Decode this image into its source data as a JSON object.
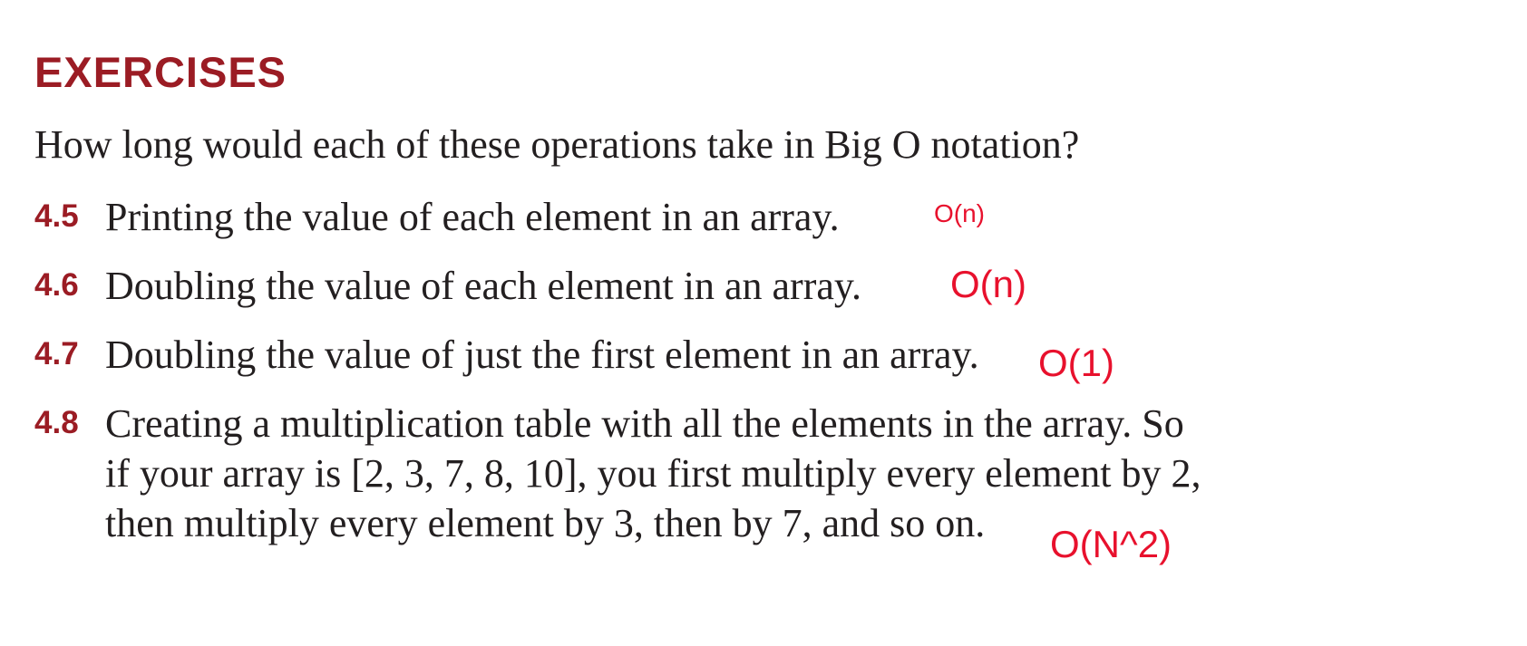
{
  "heading": "EXERCISES",
  "intro": "How long would each of these operations take in Big O notation?",
  "exercises": [
    {
      "number": "4.5",
      "lines": [
        "Printing the value of each element in an array."
      ],
      "answer": "O(n)"
    },
    {
      "number": "4.6",
      "lines": [
        "Doubling the value of each element in an array."
      ],
      "answer": "O(n)"
    },
    {
      "number": "4.7",
      "lines": [
        "Doubling the value of just the first element in an array."
      ],
      "answer": "O(1)"
    },
    {
      "number": "4.8",
      "lines": [
        "Creating a multiplication table with all the elements in the array. So",
        "if your array is [2, 3, 7, 8, 10], you first multiply every element by 2,",
        "then multiply every element by 3, then by 7, and so on."
      ],
      "answer": "O(N^2)"
    }
  ],
  "colors": {
    "heading": "#9b1c24",
    "body_text": "#231f20",
    "handwritten_answer": "#e8112d"
  }
}
